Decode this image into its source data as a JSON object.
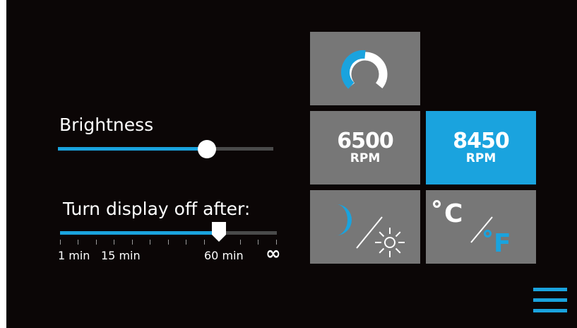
{
  "brightness": {
    "label": "Brightness",
    "level_fraction": 0.69
  },
  "display_timeout": {
    "label": "Turn display off after:",
    "selected": "60 min",
    "ticks": [
      "1 min",
      "15 min",
      "60 min",
      "∞"
    ]
  },
  "tiles": {
    "gauge": {
      "icon": "gauge-ring-icon"
    },
    "rpm_low": {
      "value": "6500",
      "unit": "RPM",
      "selected": false
    },
    "rpm_high": {
      "value": "8450",
      "unit": "RPM",
      "selected": true
    },
    "theme": {
      "icon": "moon-sun-icon"
    },
    "temperature_unit": {
      "celsius": "C",
      "fahrenheit": "F"
    }
  },
  "menu": {
    "icon": "hamburger-menu-icon"
  },
  "colors": {
    "accent": "#1aa3de",
    "tile": "#777777",
    "background": "#0b0606"
  }
}
